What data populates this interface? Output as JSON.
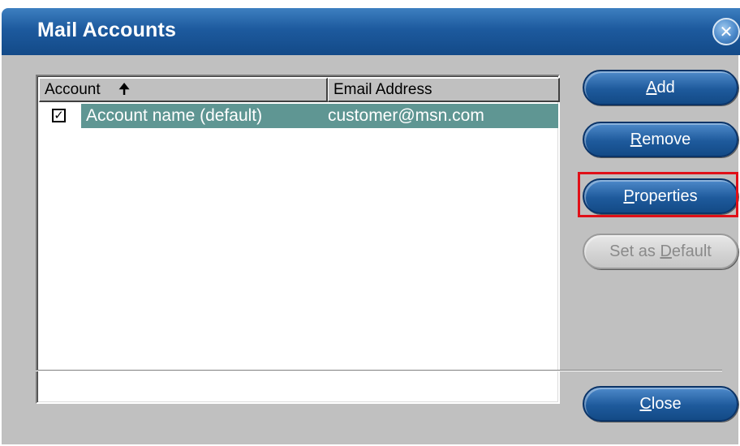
{
  "window": {
    "title": "Mail Accounts",
    "close_glyph": "✕",
    "title_color": "#1d5a9e"
  },
  "list": {
    "columns": [
      {
        "label": "Account",
        "sort_icon": "up-arrow-icon"
      },
      {
        "label": "Email Address"
      }
    ],
    "rows": [
      {
        "checked": true,
        "account": "Account name (default)",
        "email": "customer@msn.com",
        "selected": true
      }
    ],
    "selection_color": "#5f9693"
  },
  "buttons": {
    "add": {
      "mnemonic": "A",
      "rest": "dd"
    },
    "remove": {
      "mnemonic": "R",
      "rest": "emove"
    },
    "properties": {
      "mnemonic": "P",
      "rest": "roperties",
      "highlighted": true
    },
    "set_default": {
      "prefix": "Set as ",
      "mnemonic": "D",
      "rest": "efault",
      "enabled": false
    },
    "close": {
      "mnemonic": "C",
      "rest": "lose"
    }
  },
  "highlight_color": "#e01018"
}
